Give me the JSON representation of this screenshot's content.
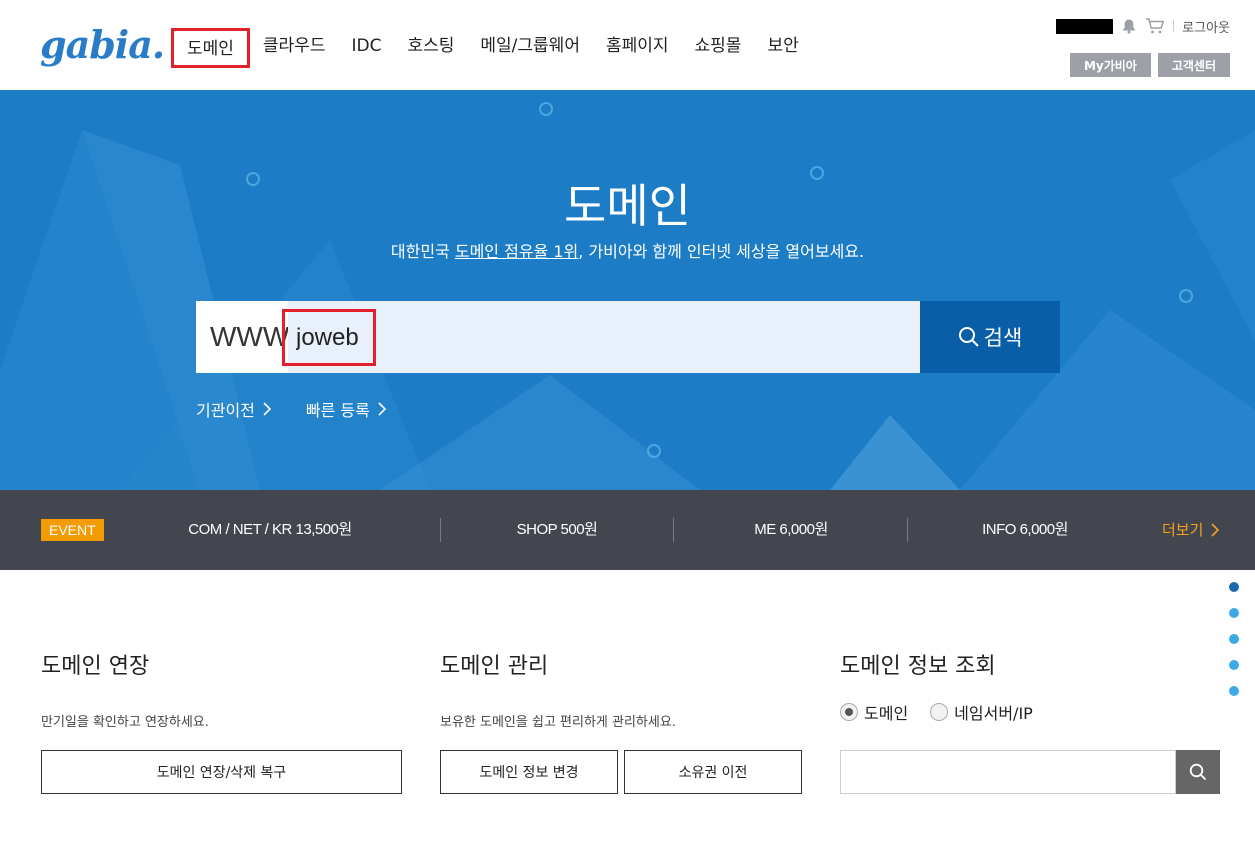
{
  "header": {
    "logo": "gabia",
    "logo_dot": ".",
    "nav": [
      {
        "label": "도메인",
        "active": true
      },
      {
        "label": "클라우드"
      },
      {
        "label": "IDC"
      },
      {
        "label": "호스팅"
      },
      {
        "label": "메일/그룹웨어"
      },
      {
        "label": "홈페이지"
      },
      {
        "label": "쇼핑몰"
      },
      {
        "label": "보안"
      }
    ],
    "util": {
      "logout": "로그아웃"
    },
    "buttons": {
      "my_gabia": "My가비아",
      "support": "고객센터"
    }
  },
  "hero": {
    "title": "도메인",
    "subtitle_pre": "대한민국 ",
    "subtitle_link": "도메인 점유율 1위",
    "subtitle_post": ", 가비아와 함께 인터넷 세상을 열어보세요.",
    "search_prefix": "WWW.",
    "search_value": "joweb",
    "search_button": "검색",
    "links": {
      "transfer": "기관이전",
      "quick_register": "빠른 등록"
    }
  },
  "event": {
    "badge": "EVENT",
    "items": [
      "COM / NET / KR 13,500원",
      "SHOP 500원",
      "ME 6,000원",
      "INFO 6,000원"
    ],
    "more": "더보기"
  },
  "sections": {
    "renew": {
      "title": "도메인 연장",
      "desc": "만기일을 확인하고 연장하세요.",
      "button": "도메인 연장/삭제 복구"
    },
    "manage": {
      "title": "도메인 관리",
      "desc": "보유한 도메인을 쉽고 편리하게 관리하세요.",
      "button_change": "도메인 정보 변경",
      "button_owner": "소유권 이전"
    },
    "lookup": {
      "title": "도메인 정보 조회",
      "radio_domain": "도메인",
      "radio_ns": "네임서버/IP",
      "search_value": ""
    }
  },
  "colors": {
    "brand": "#1c7dc6",
    "search_button": "#0a5ea8",
    "event_bar": "#43464f",
    "event_accent": "#f29b05",
    "highlight": "#e2202e"
  }
}
